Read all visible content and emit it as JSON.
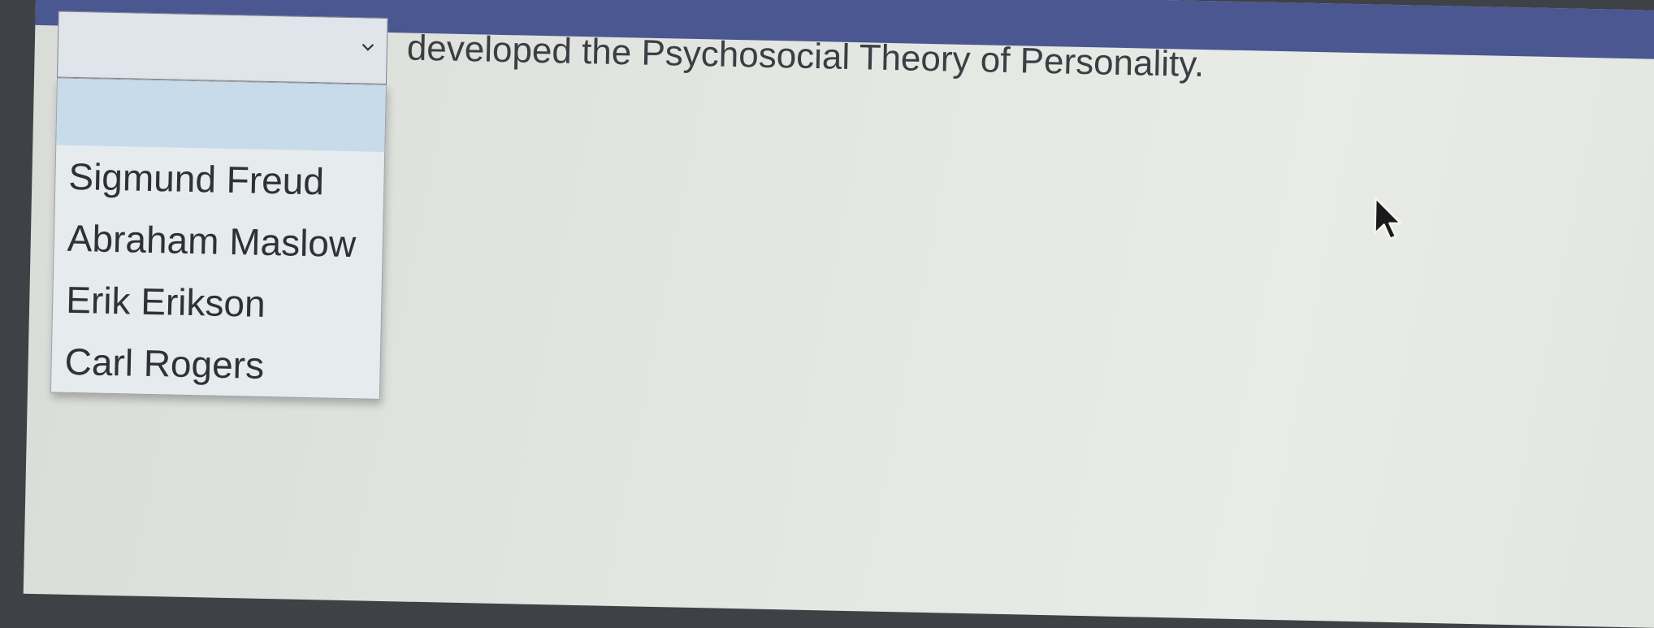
{
  "question": {
    "sentence": "developed the Psychosocial Theory of Personality."
  },
  "dropdown": {
    "selected_value": "",
    "options": [
      {
        "label": ""
      },
      {
        "label": "Sigmund Freud"
      },
      {
        "label": "Abraham Maslow"
      },
      {
        "label": "Erik Erikson"
      },
      {
        "label": "Carl Rogers"
      }
    ]
  },
  "colors": {
    "header": "#4a5790",
    "highlight": "#c8dbea",
    "background": "#e6e8e4"
  },
  "icons": {
    "chevron": "chevron-down-icon",
    "pointer": "mouse-cursor-icon"
  }
}
